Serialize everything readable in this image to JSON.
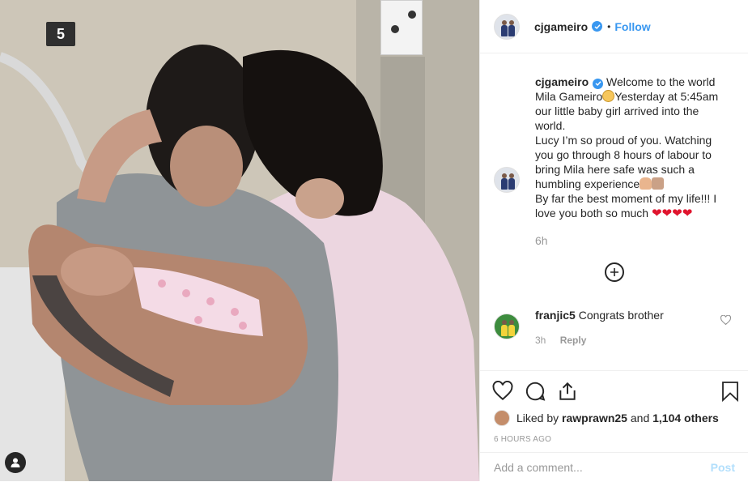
{
  "photo": {
    "room_number": "5",
    "user_tag_icon": "person-icon"
  },
  "header": {
    "username": "cjgameiro",
    "separator": "•",
    "follow_label": "Follow",
    "verified_icon": "verified-badge-icon"
  },
  "caption": {
    "username": "cjgameiro",
    "line1_a": "Welcome to the world Mila Gameiro",
    "line1_b": "Yesterday at 5:45am our little baby girl arrived into the world.",
    "line2": "Lucy I’m so proud of you. Watching you go through 8 hours of labour to bring Mila here safe was such a humbling experience",
    "line3": "By far the best moment of my life!!! I love you both so much",
    "hearts": "❤❤❤❤",
    "time": "6h"
  },
  "comment": {
    "username": "franjic5",
    "text": "Congrats brother",
    "time": "3h",
    "reply_label": "Reply"
  },
  "likes": {
    "prefix": "Liked by",
    "liker": "rawprawn25",
    "and": "and",
    "others": "1,104 others"
  },
  "timestamp": "6 HOURS AGO",
  "add_comment": {
    "placeholder": "Add a comment...",
    "post_label": "Post"
  },
  "colors": {
    "accent": "#3897f0",
    "post_disabled": "#b2dffc",
    "muted": "#999999",
    "heart": "#e0142e"
  }
}
